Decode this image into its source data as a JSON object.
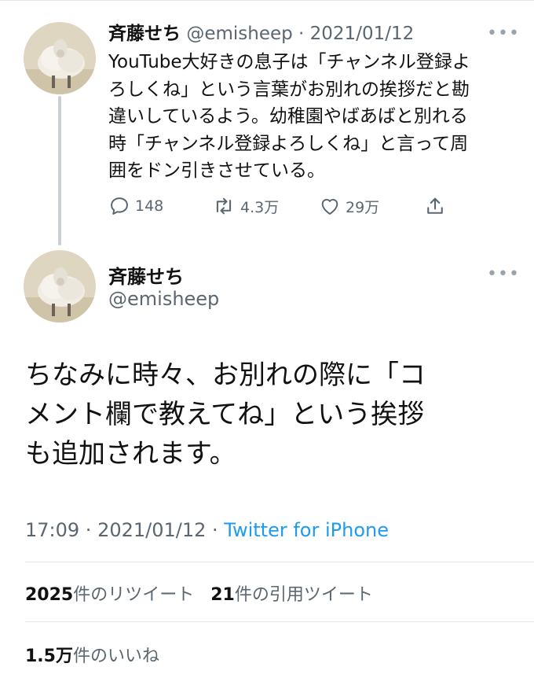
{
  "tweet1": {
    "name": "斉藤せち",
    "handle": "@emisheep",
    "sep": " · ",
    "date": "2021/01/12",
    "lines": [
      "YouTube大好きの息子は「チャンネル登録よ",
      "ろしくね」という言葉がお別れの挨拶だと勘",
      "違いしているよう。幼稚園やばあばと別れる",
      "時「チャンネル登録よろしくね」と言って周",
      "囲をドン引きさせている。"
    ],
    "actions": {
      "replies": "148",
      "retweets": "4.3万",
      "likes": "29万"
    }
  },
  "tweet2": {
    "name": "斉藤せち",
    "handle": "@emisheep",
    "lines": [
      "ちなみに時々、お別れの際に「コ",
      "メント欄で教えてね」という挨拶",
      "も追加されます。"
    ],
    "time": "17:09",
    "sep": " · ",
    "date": "2021/01/12",
    "sep2": " · ",
    "source": "Twitter for iPhone",
    "retweet_count": "2025",
    "retweet_label": "件のリツイート",
    "quote_count": "21",
    "quote_label": "件の引用ツイート",
    "like_count": "1.5万",
    "like_label": "件のいいね"
  },
  "more_glyph": "•••",
  "icons": {
    "reply": "reply-icon",
    "retweet": "retweet-icon",
    "like": "heart-icon",
    "share": "share-icon",
    "avatar": "sheep-avatar"
  },
  "colors": {
    "link": "#1d9bf0",
    "muted": "#5b6670",
    "text": "#111111"
  }
}
